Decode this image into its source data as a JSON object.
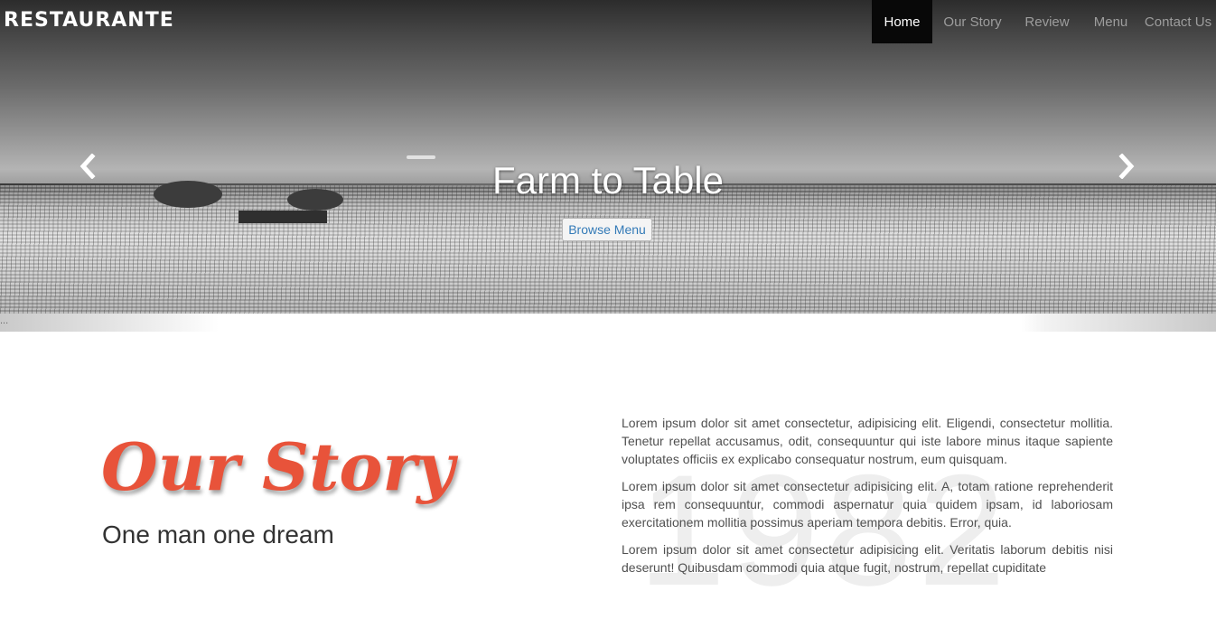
{
  "brand": "RESTAURANTE",
  "nav": {
    "items": [
      "Home",
      "Our Story",
      "Review",
      "Menu",
      "Contact Us"
    ],
    "active": "Home"
  },
  "hero": {
    "caption": "Farm to Table",
    "button_label": "Browse Menu",
    "prev_icon": "chevron-left-icon",
    "next_icon": "chevron-right-icon"
  },
  "strip_text": "...",
  "story": {
    "title": "Our Story",
    "subtitle": "One man one dream",
    "year": "1982",
    "paragraphs": [
      "Lorem ipsum dolor sit amet consectetur, adipisicing elit. Eligendi, consectetur mollitia. Tenetur repellat accusamus, odit, consequuntur qui iste labore minus itaque sapiente voluptates officiis ex explicabo consequatur nostrum, eum quisquam.",
      "Lorem ipsum dolor sit amet consectetur adipisicing elit. A, totam ratione reprehenderit ipsa rem consequuntur, commodi aspernatur quia quidem ipsam, id laboriosam exercitationem mollitia possimus aperiam tempora debitis. Error, quia.",
      "Lorem ipsum dolor sit amet consectetur adipisicing elit. Veritatis laborum debitis nisi deserunt! Quibusdam commodi quia atque fugit, nostrum, repellat cupiditate"
    ]
  },
  "colors": {
    "accent": "#e8533a",
    "nav_active_bg": "#080808",
    "nav_text": "#9d9d9d",
    "link": "#337ab7"
  }
}
